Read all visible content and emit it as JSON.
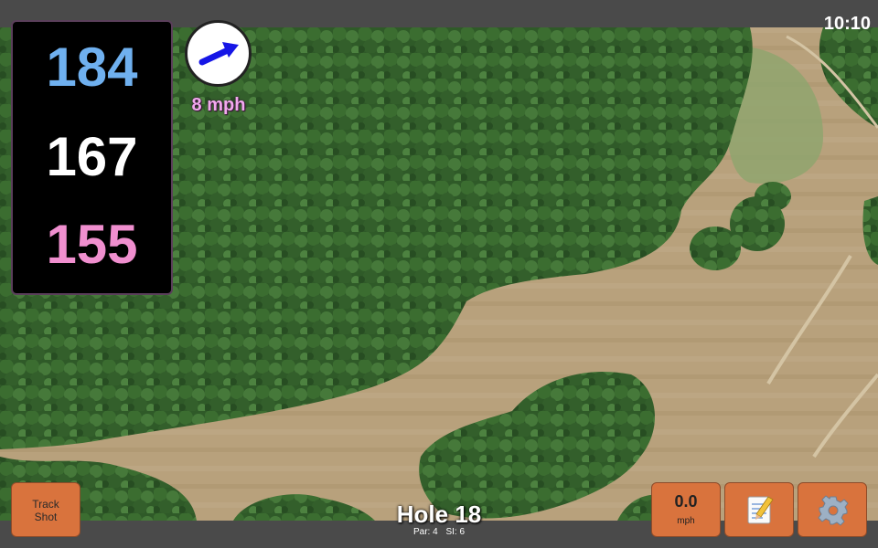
{
  "status": {
    "time": "10:10"
  },
  "distances": {
    "back": "184",
    "middle": "167",
    "front": "155"
  },
  "wind": {
    "speed": "8 mph",
    "icon": "wind-arrow-icon"
  },
  "hole": {
    "title": "Hole 18",
    "par": "Par: 4",
    "stroke_index": "SI: 6"
  },
  "buttons": {
    "track_shot": [
      "Track",
      "Shot"
    ],
    "speed_value": "0.0",
    "speed_unit": "mph",
    "notes_icon": "notepad-icon",
    "settings_icon": "gear-icon"
  },
  "colors": {
    "back_distance": "#6fb0ef",
    "middle_distance": "#ffffff",
    "front_distance": "#f08fcf",
    "button_fill": "#d9733d",
    "wind_label": "#f2a9ee"
  }
}
